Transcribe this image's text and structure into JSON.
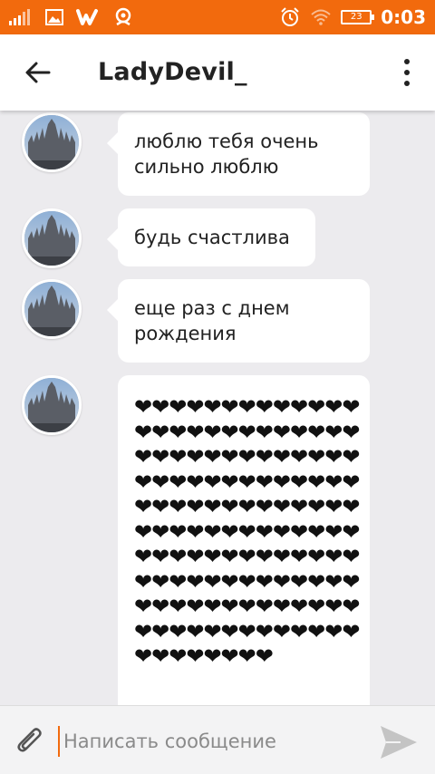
{
  "status_bar": {
    "time": "0:03",
    "battery": "23",
    "icons": [
      "signal-icon",
      "image-icon",
      "wattpad-icon",
      "ok-icon",
      "alarm-icon",
      "wifi-icon",
      "battery-icon"
    ]
  },
  "toolbar": {
    "title": "LadyDevil_",
    "back_icon": "arrow-left-icon",
    "menu_icon": "more-vertical-icon"
  },
  "messages": [
    {
      "text": "люблю тебя очень сильно люблю"
    },
    {
      "text": "будь счастлива"
    },
    {
      "text": "еще раз с днем рождения"
    },
    {
      "text": "❤❤❤❤❤❤❤❤❤❤❤❤❤❤❤❤❤❤❤❤❤❤❤❤❤❤❤❤❤❤❤❤❤❤❤❤❤❤❤❤❤❤❤❤❤❤❤❤❤❤❤❤❤❤❤❤❤❤❤❤❤❤❤❤❤❤❤❤❤❤❤❤❤❤❤❤❤❤❤❤❤❤❤❤❤❤❤❤❤❤❤❤❤❤❤❤❤❤❤❤❤❤❤❤❤❤❤❤❤❤❤❤❤❤❤❤❤❤❤❤❤❤❤❤❤❤❤❤❤❤❤❤❤❤❤❤❤❤"
    }
  ],
  "composer": {
    "placeholder": "Написать сообщение",
    "attach_icon": "paperclip-icon",
    "send_icon": "send-icon"
  },
  "colors": {
    "accent": "#f26a0d",
    "background": "#ecebee",
    "bubble": "#ffffff"
  }
}
